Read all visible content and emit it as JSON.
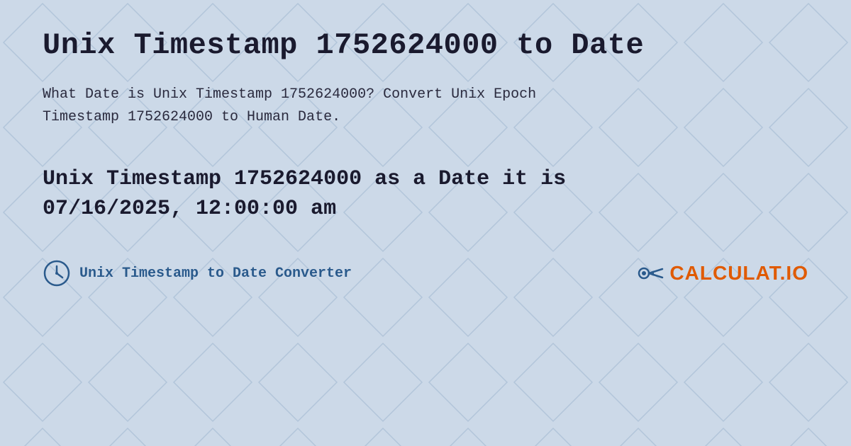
{
  "page": {
    "background_color": "#c8d8e8",
    "title": "Unix Timestamp 1752624000 to Date",
    "description_line1": "What Date is Unix Timestamp 1752624000? Convert Unix Epoch",
    "description_line2": "Timestamp 1752624000 to Human Date.",
    "result_line1": "Unix Timestamp 1752624000 as a Date it is",
    "result_line2": "07/16/2025, 12:00:00 am",
    "footer_label": "Unix Timestamp to Date Converter",
    "logo_text": "CALCULAT.IO"
  }
}
